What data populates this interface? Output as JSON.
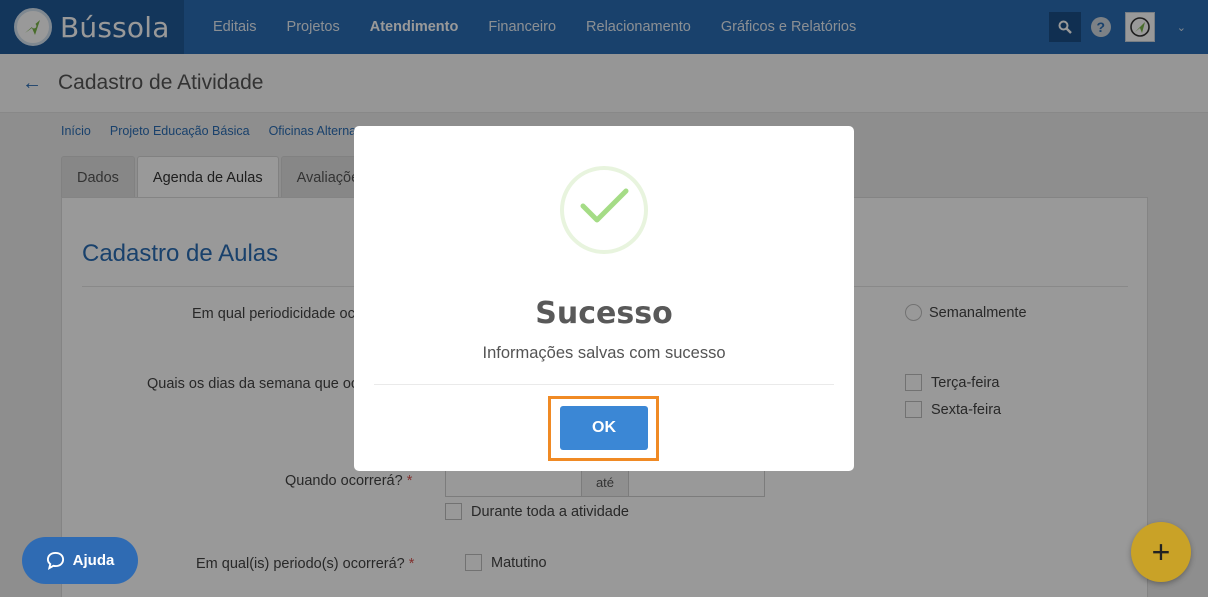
{
  "app": {
    "name": "Bússola"
  },
  "nav": {
    "items": [
      {
        "label": "Editais",
        "active": false
      },
      {
        "label": "Projetos",
        "active": false
      },
      {
        "label": "Atendimento",
        "active": true
      },
      {
        "label": "Financeiro",
        "active": false
      },
      {
        "label": "Relacionamento",
        "active": false
      },
      {
        "label": "Gráficos e Relatórios",
        "active": false
      }
    ],
    "help_glyph": "?"
  },
  "page": {
    "title": "Cadastro de Atividade",
    "breadcrumb": [
      "Início",
      "Projeto Educação Básica",
      "Oficinas Alterna"
    ],
    "tabs": [
      {
        "label": "Dados",
        "active": false
      },
      {
        "label": "Agenda de Aulas",
        "active": true
      },
      {
        "label": "Avaliaçõe",
        "active": false
      }
    ]
  },
  "form": {
    "section_title": "Cadastro de Aulas",
    "q_periodicidade": "Em qual periodicidade oc",
    "opt_semanalmente": "Semanalmente",
    "q_dias": "Quais os dias da semana que oc",
    "opt_terca": "Terça-feira",
    "opt_sexta": "Sexta-feira",
    "q_quando": "Quando ocorrerá?",
    "required_mark": "*",
    "date_separator": "até",
    "opt_durante": "Durante toda a atividade",
    "q_periodos": "Em qual(is) periodo(s) ocorrerá?",
    "opt_matutino": "Matutino"
  },
  "modal": {
    "title": "Sucesso",
    "message": "Informações salvas com sucesso",
    "ok_label": "OK"
  },
  "floating": {
    "help_label": "Ajuda",
    "add_glyph": "+"
  },
  "colors": {
    "nav_bg": "#2a6db4",
    "accent": "#3b87d5",
    "success": "#a5dc86",
    "highlight": "#f08a24",
    "fab": "#c9a227"
  }
}
